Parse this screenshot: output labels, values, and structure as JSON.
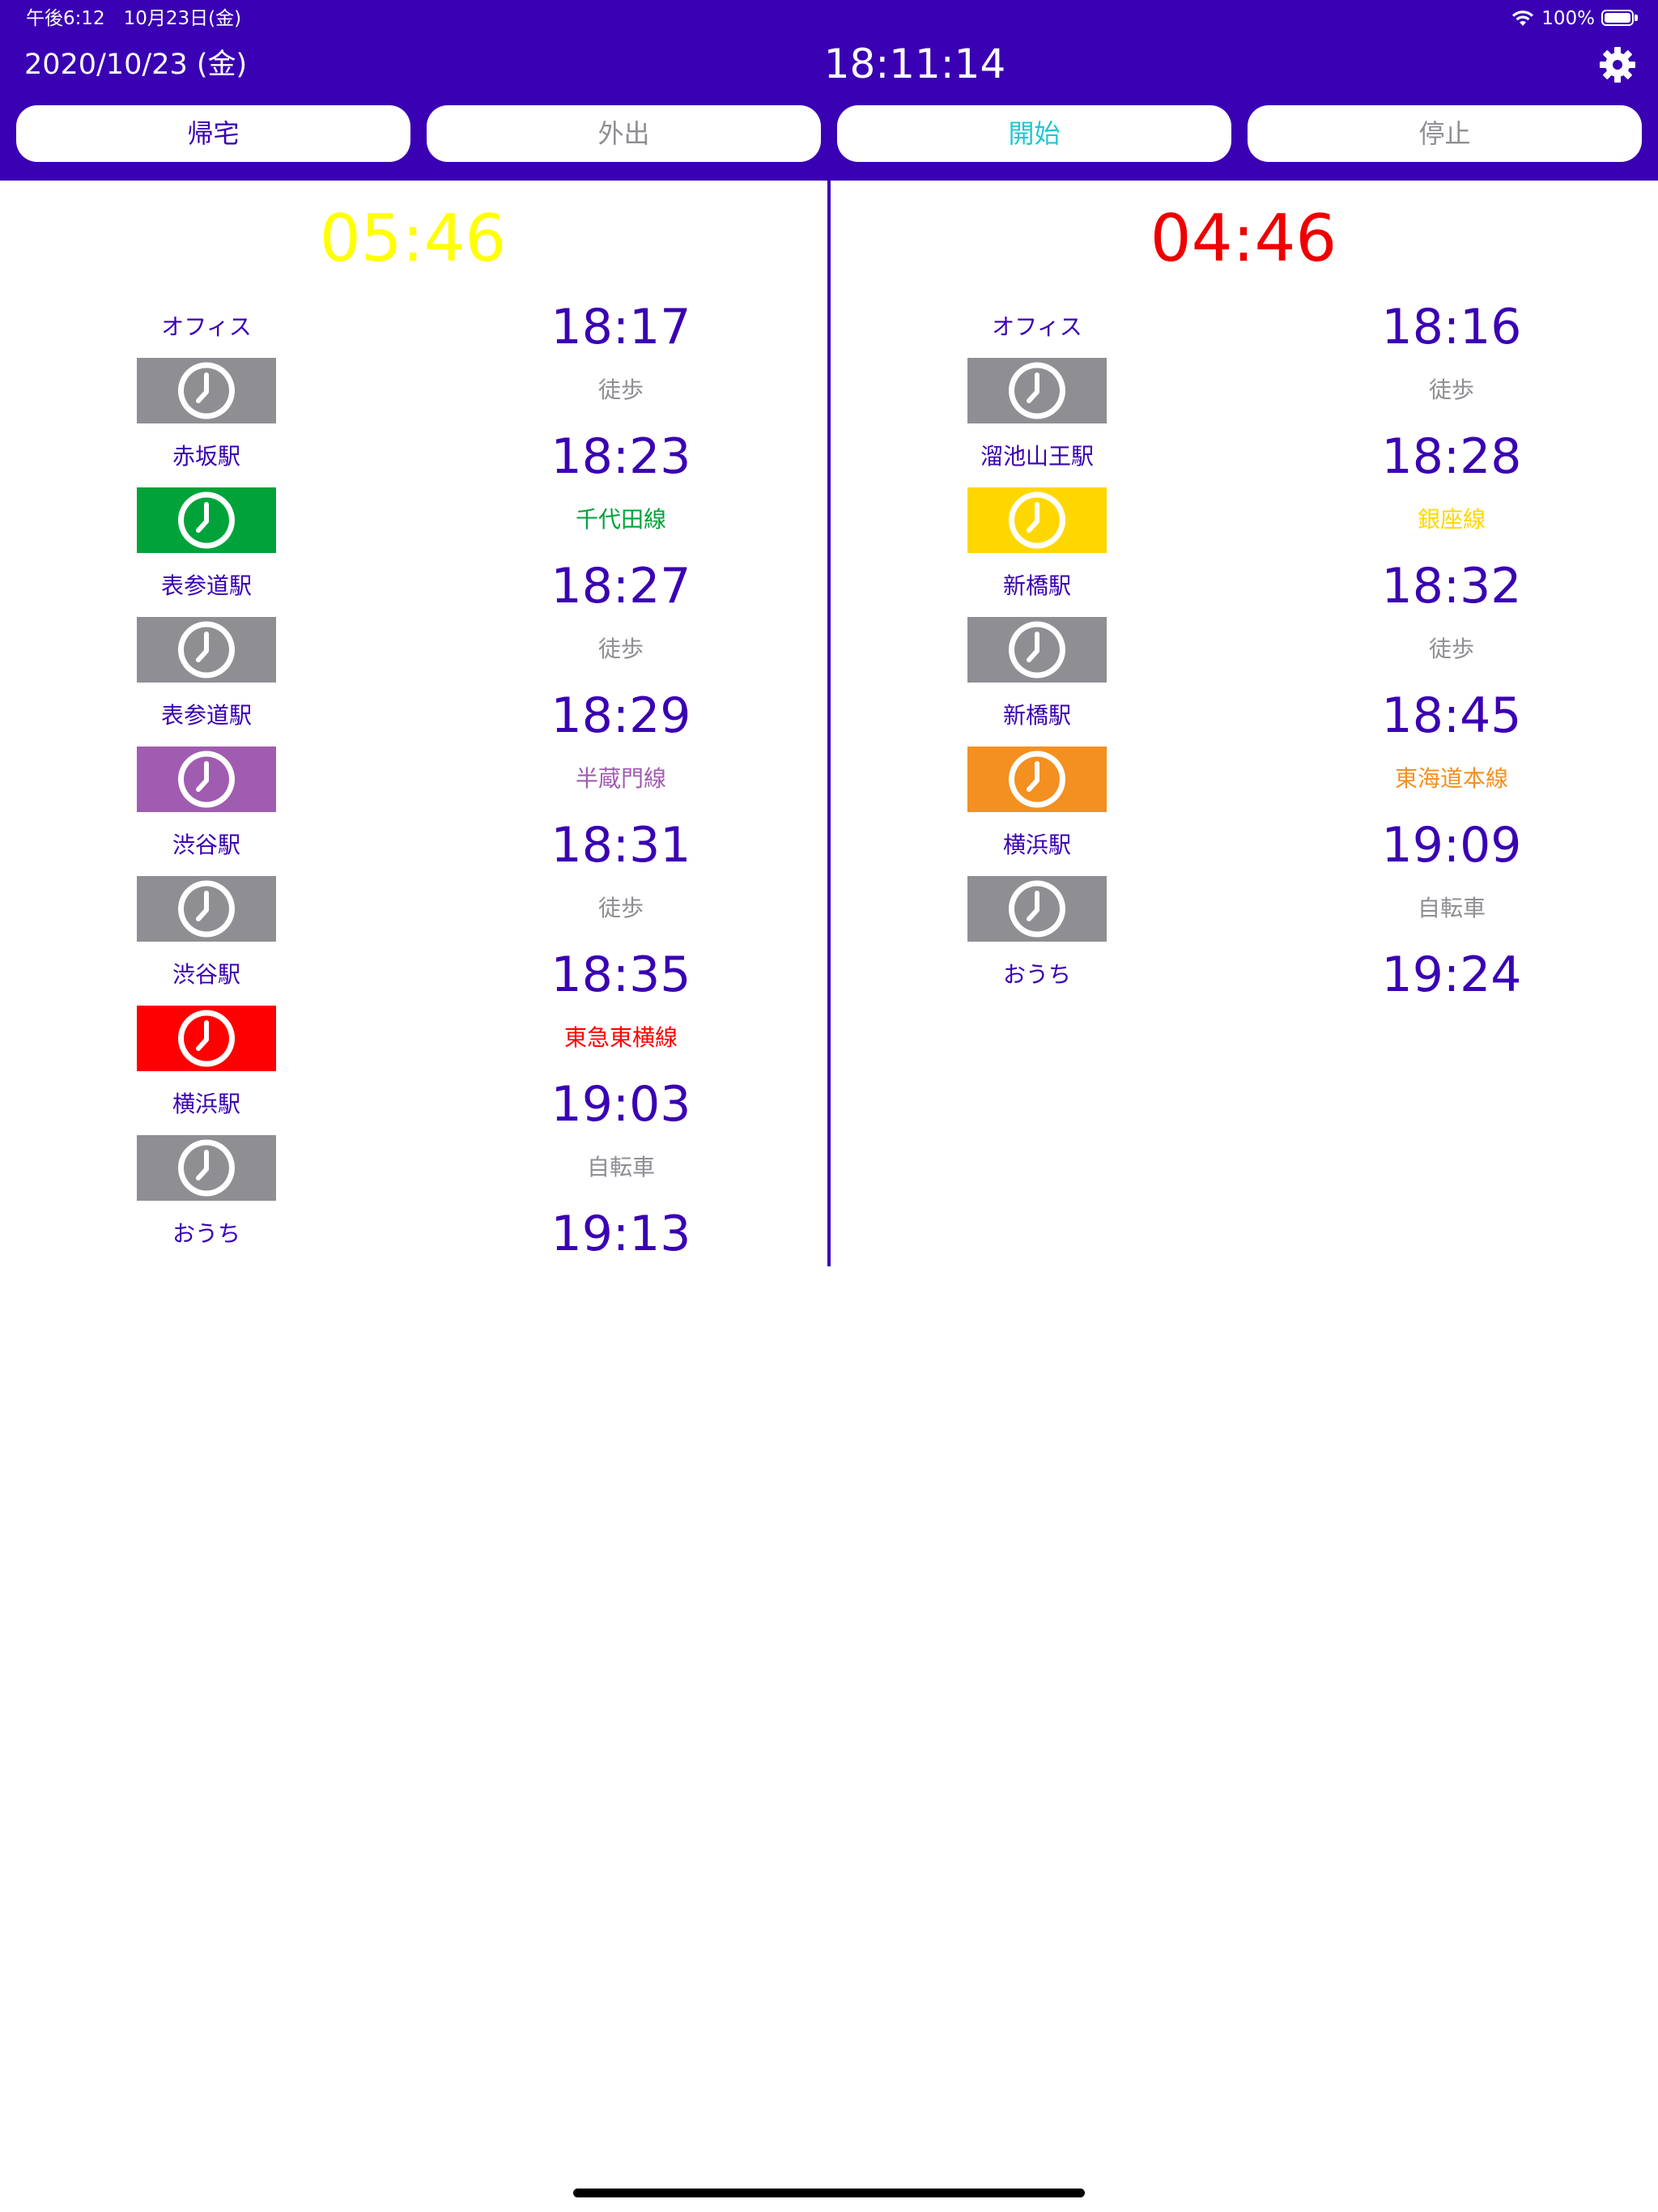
{
  "status_bar": {
    "time": "午後6:12　10月23日(金)",
    "battery": "100%"
  },
  "header": {
    "date": "2020/10/23 (金)",
    "clock": "18:11:14",
    "settings_icon": "gear-icon"
  },
  "tabs": [
    {
      "label": "帰宅",
      "color": "#3a00b3"
    },
    {
      "label": "外出",
      "color": "#8e8e93"
    },
    {
      "label": "開始",
      "color": "#1ec8d2"
    },
    {
      "label": "停止",
      "color": "#8e8e93"
    }
  ],
  "routes": [
    {
      "countdown": "05:46",
      "countdown_color": "#ffff00",
      "stops": [
        {
          "station": "オフィス",
          "time": "18:17"
        },
        {
          "station": "赤坂駅",
          "time": "18:23"
        },
        {
          "station": "表参道駅",
          "time": "18:27"
        },
        {
          "station": "表参道駅",
          "time": "18:29"
        },
        {
          "station": "渋谷駅",
          "time": "18:31"
        },
        {
          "station": "渋谷駅",
          "time": "18:35"
        },
        {
          "station": "横浜駅",
          "time": "19:03"
        },
        {
          "station": "おうち",
          "time": "19:13"
        }
      ],
      "legs": [
        {
          "mode": "徒歩",
          "color": "#8e8e93",
          "icon": "clock-icon"
        },
        {
          "mode": "千代田線",
          "color": "#00a33a",
          "icon": "clock-icon"
        },
        {
          "mode": "徒歩",
          "color": "#8e8e93",
          "icon": "clock-icon"
        },
        {
          "mode": "半蔵門線",
          "color": "#a05cb0",
          "icon": "clock-icon"
        },
        {
          "mode": "徒歩",
          "color": "#8e8e93",
          "icon": "clock-icon"
        },
        {
          "mode": "東急東横線",
          "color": "#ff0000",
          "icon": "clock-icon"
        },
        {
          "mode": "自転車",
          "color": "#8e8e93",
          "icon": "clock-icon"
        }
      ]
    },
    {
      "countdown": "04:46",
      "countdown_color": "#ee0000",
      "stops": [
        {
          "station": "オフィス",
          "time": "18:16"
        },
        {
          "station": "溜池山王駅",
          "time": "18:28"
        },
        {
          "station": "新橋駅",
          "time": "18:32"
        },
        {
          "station": "新橋駅",
          "time": "18:45"
        },
        {
          "station": "横浜駅",
          "time": "19:09"
        },
        {
          "station": "おうち",
          "time": "19:24"
        }
      ],
      "legs": [
        {
          "mode": "徒歩",
          "color": "#8e8e93",
          "icon": "clock-icon"
        },
        {
          "mode": "銀座線",
          "color": "#ffd700",
          "icon": "clock-icon"
        },
        {
          "mode": "徒歩",
          "color": "#8e8e93",
          "icon": "clock-icon"
        },
        {
          "mode": "東海道本線",
          "color": "#f39020",
          "icon": "clock-icon"
        },
        {
          "mode": "自転車",
          "color": "#8e8e93",
          "icon": "clock-icon"
        }
      ]
    }
  ]
}
